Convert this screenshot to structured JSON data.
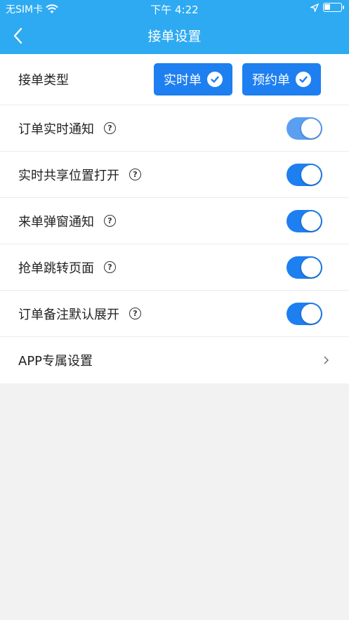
{
  "status": {
    "carrier": "无SIM卡",
    "time": "下午 4:22"
  },
  "nav": {
    "title": "接单设置"
  },
  "order_type": {
    "label": "接单类型",
    "buttons": [
      "实时单",
      "预约单"
    ]
  },
  "settings": [
    {
      "label": "订单实时通知",
      "on": true
    },
    {
      "label": "实时共享位置打开",
      "on": true
    },
    {
      "label": "来单弹窗通知",
      "on": true
    },
    {
      "label": "抢单跳转页面",
      "on": true
    },
    {
      "label": "订单备注默认展开",
      "on": true
    }
  ],
  "app_settings": {
    "label": "APP专属设置"
  },
  "help_glyph": "?",
  "colors": {
    "header": "#2eaaf2",
    "accent": "#1e7ff0"
  }
}
